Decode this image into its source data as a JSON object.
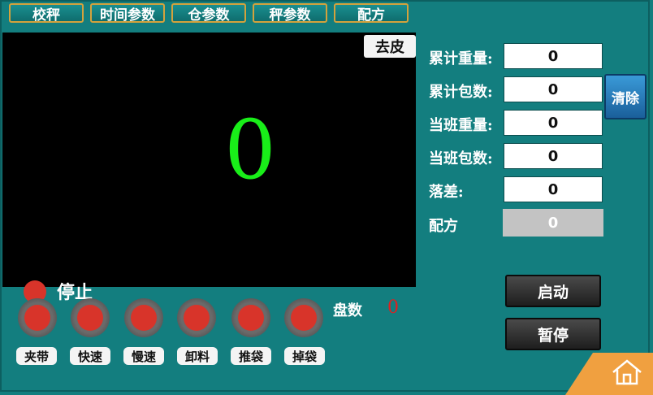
{
  "tabs": [
    "校秤",
    "时间参数",
    "仓参数",
    "秤参数",
    "配方"
  ],
  "display": {
    "tare_label": "去皮",
    "weight": "0",
    "status_label": "停止",
    "tray_label": "盘数",
    "tray_value": "0"
  },
  "indicators": [
    {
      "label": "夹带"
    },
    {
      "label": "快速"
    },
    {
      "label": "慢速"
    },
    {
      "label": "卸料"
    },
    {
      "label": "推袋"
    },
    {
      "label": "掉袋"
    }
  ],
  "fields": [
    {
      "label": "累计重量:",
      "value": "0"
    },
    {
      "label": "累计包数:",
      "value": "0"
    },
    {
      "label": "当班重量:",
      "value": "0"
    },
    {
      "label": "当班包数:",
      "value": "0"
    },
    {
      "label": "落差:",
      "value": "0"
    }
  ],
  "recipe": {
    "label": "配方",
    "value": "0"
  },
  "buttons": {
    "clear": "清除",
    "start": "启动",
    "pause": "暂停"
  },
  "colors": {
    "background": "#137e7f",
    "weight_digits": "#19ee19",
    "status_red": "#d8342a",
    "home_corner": "#f0a040"
  },
  "icons": {
    "home": "home-icon"
  }
}
